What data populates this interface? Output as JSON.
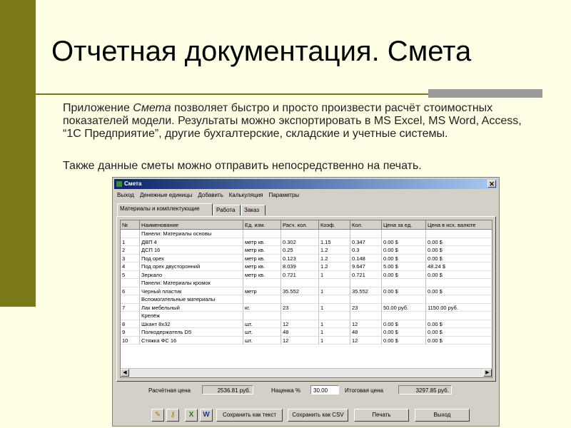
{
  "slide": {
    "title": "Отчетная документация. Смета",
    "para1_a": "Приложение ",
    "para1_em": "Смета",
    "para1_b": " позволяет быстро и просто произвести расчёт стоимостных показателей модели. Результаты можно экспортировать в MS Excel, MS Word, Access, “1С Предприятие”, другие бухгалтерские, складские и учетные системы.",
    "para2": "Также данные сметы можно отправить непосредственно на печать.",
    "colors": {
      "background": "#ffffe5",
      "accent": "#7a7a18",
      "gray_box": "#9a9a9a"
    }
  },
  "window": {
    "title": "Смета",
    "close_glyph": "✕",
    "menu": [
      "Выход",
      "Денежные единицы",
      "Добавить",
      "Калькуляция",
      "Параметры"
    ],
    "tabs": [
      "Материалы и комплектующие",
      "Работа",
      "Заказ"
    ],
    "columns": [
      "№",
      "Наименование",
      "Ед. изм.",
      "Расч. кол.",
      "Коэф.",
      "Кол.",
      "Цена за ед.",
      "Цена в исх. валюте"
    ],
    "rows": [
      [
        "",
        "Панели: Материалы основы",
        "",
        "",
        "",
        "",
        "",
        ""
      ],
      [
        "1",
        "ДВП 4",
        "метр кв.",
        "0.302",
        "1.15",
        "0.347",
        "0.00 $",
        "0.00 $"
      ],
      [
        "2",
        "ДСП 16",
        "метр кв.",
        "0.25",
        "1.2",
        "0.3",
        "0.00 $",
        "0.00 $"
      ],
      [
        "3",
        "Под орех",
        "метр кв.",
        "0.123",
        "1.2",
        "0.148",
        "0.00 $",
        "0.00 $"
      ],
      [
        "4",
        "Под орех двусторонний",
        "метр кв.",
        "8.039",
        "1.2",
        "9.647",
        "5.00 $",
        "48.24 $"
      ],
      [
        "5",
        "Зеркало",
        "метр кв.",
        "0.721",
        "1",
        "0.721",
        "0.00 $",
        "0.00 $"
      ],
      [
        "",
        "Панели: Материалы кромок",
        "",
        "",
        "",
        "",
        "",
        ""
      ],
      [
        "6",
        "Черный пластик",
        "метр",
        "35.552",
        "1",
        "35.552",
        "0.00 $",
        "0.00 $"
      ],
      [
        "",
        "Вспомогательные материалы",
        "",
        "",
        "",
        "",
        "",
        ""
      ],
      [
        "7",
        "Лак мебельный",
        "кг.",
        "23",
        "1",
        "23",
        "50.00 руб.",
        "1150.00 руб."
      ],
      [
        "",
        "Крепёж",
        "",
        "",
        "",
        "",
        "",
        ""
      ],
      [
        "8",
        "Шкант 8x32",
        "шт.",
        "12",
        "1",
        "12",
        "0.00 $",
        "0.00 $"
      ],
      [
        "9",
        "Полкодержатель D5",
        "шт.",
        "48",
        "1",
        "48",
        "0.00 $",
        "0.00 $"
      ],
      [
        "10",
        "Стяжка ФС 16",
        "шт.",
        "12",
        "1",
        "12",
        "0.00 $",
        "0.00 $"
      ]
    ],
    "summary": {
      "calc_price_label": "Расчётная цена",
      "calc_price_value": "2536.81 руб.",
      "markup_label": "Наценка %",
      "markup_value": "30.00",
      "total_label": "Итоговая цена",
      "total_value": "3297.85 руб."
    },
    "buttons": {
      "save_text": "Сохранить как текст",
      "save_csv": "Сохранить как CSV",
      "print": "Печать",
      "exit": "Выход"
    },
    "icons": [
      "pencil-icon",
      "key-icon",
      "excel-icon",
      "word-icon"
    ]
  }
}
